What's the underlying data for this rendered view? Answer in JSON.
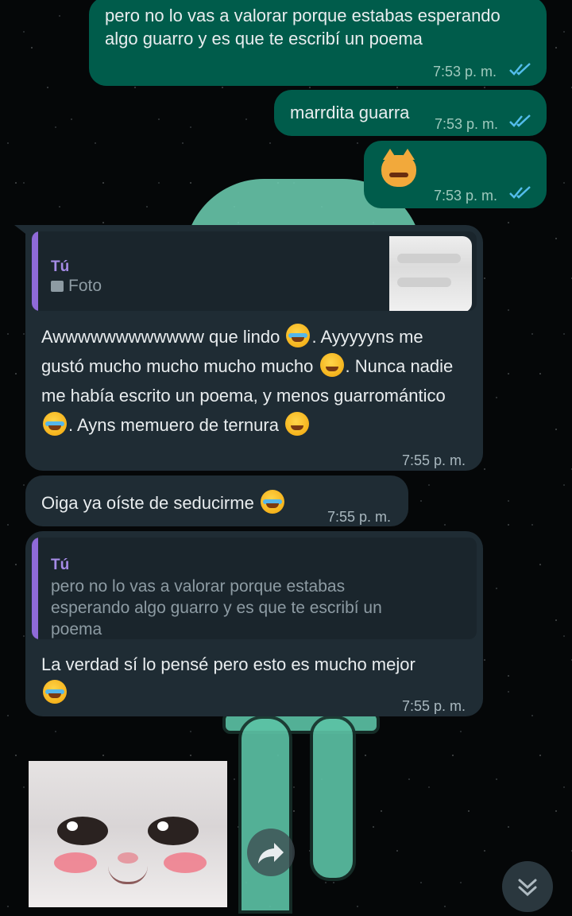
{
  "messages": {
    "m1": {
      "text": "pero no lo vas a valorar porque estabas esperando algo guarro y es que te escribí un poema",
      "time": "7:53 p. m."
    },
    "m2": {
      "text": "marrdita guarra",
      "time": "7:53 p. m."
    },
    "m3": {
      "emoji": "pouting-cat-face",
      "time": "7:53 p. m."
    },
    "m4": {
      "quote_author": "Tú",
      "quote_text": "Foto",
      "text_1": "Awwwwwwwwwwww que lindo ",
      "text_2": ". Ayyyyyns me gustó mucho mucho mucho mucho ",
      "text_3": ". Nunca nadie me había escrito un poema, y menos guarromántico",
      "text_4": ". Ayns memuero de ternura ",
      "time": "7:55 p. m."
    },
    "m5": {
      "text": "Oiga ya oíste de seducirme ",
      "time": "7:55 p. m."
    },
    "m6": {
      "quote_author": "Tú",
      "quote_text": "pero no lo vas a valorar porque estabas esperando algo guarro y es que te escribí un poema",
      "text": "La verdad sí lo pensé pero esto es mucho mejor",
      "time": "7:55 p. m."
    }
  },
  "colors": {
    "outgoing_bubble": "#005c4b",
    "incoming_bubble": "#1f2c34",
    "read_ticks": "#53bdeb",
    "quote_bar": "#8f6ad8"
  },
  "icons": {
    "read_receipt": "double-check-icon",
    "forward": "forward-arrow-icon",
    "scroll_down": "double-chevron-down-icon",
    "photo": "image-icon"
  }
}
